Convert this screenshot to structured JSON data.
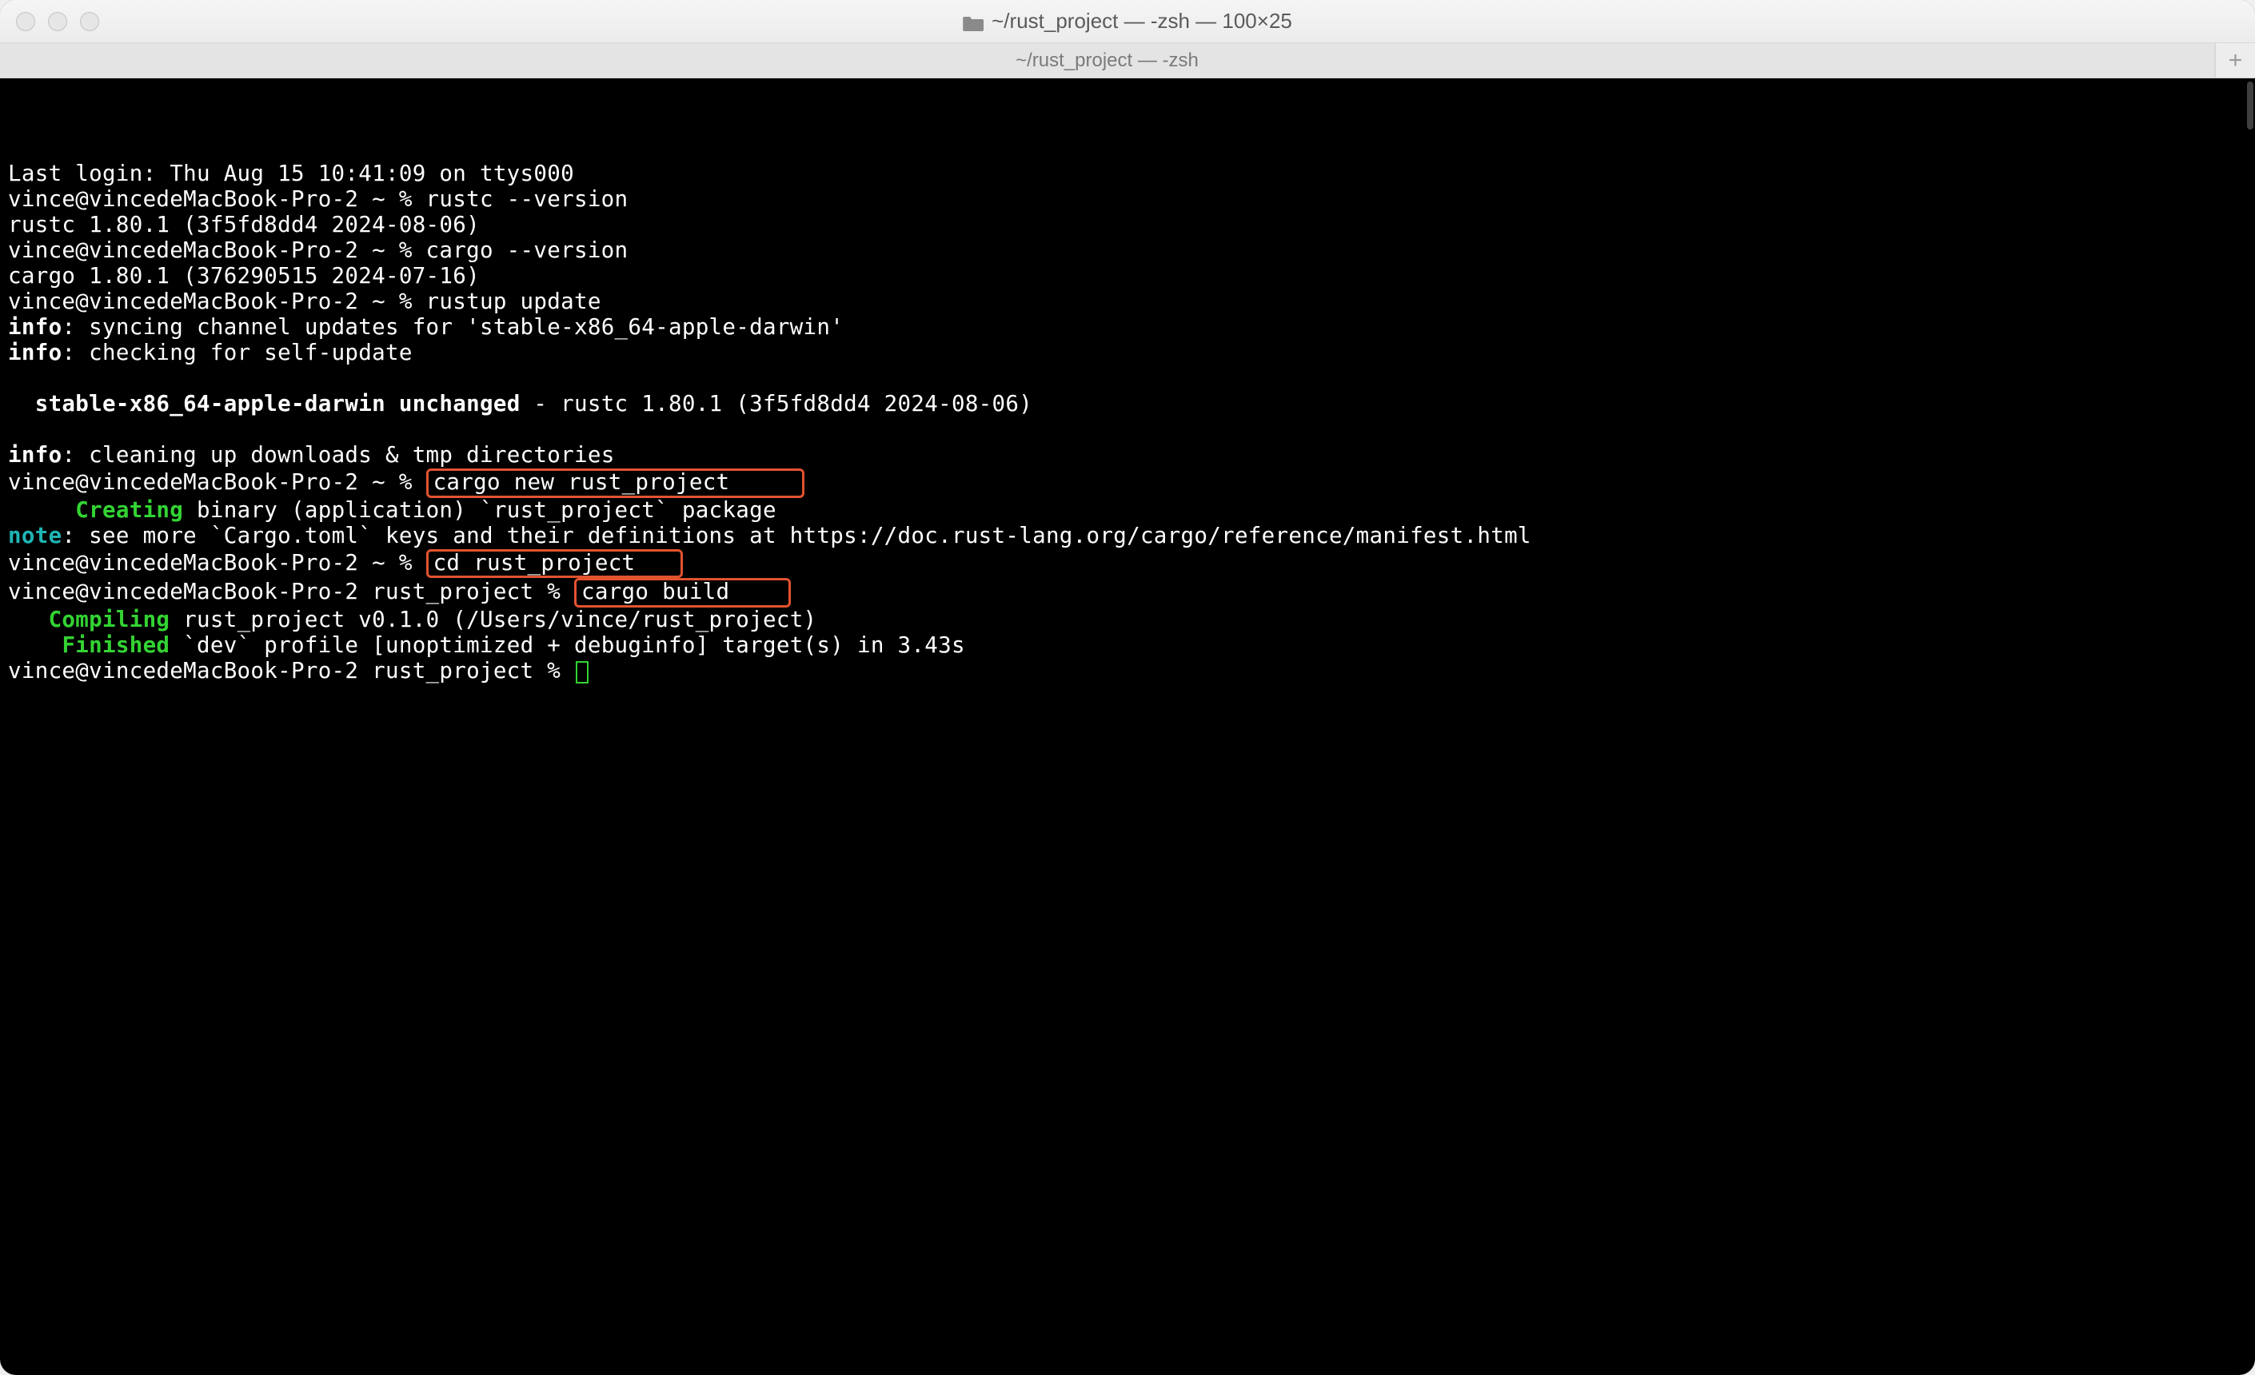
{
  "window": {
    "title": "~/rust_project — -zsh — 100×25"
  },
  "tab": {
    "label": "~/rust_project — -zsh"
  },
  "terminal": {
    "lines": [
      {
        "t": "plain",
        "text": "Last login: Thu Aug 15 10:41:09 on ttys000"
      },
      {
        "t": "prompt",
        "prompt": "vince@vincedeMacBook-Pro-2 ~ %",
        "cmd": "rustc --version"
      },
      {
        "t": "plain",
        "text": "rustc 1.80.1 (3f5fd8dd4 2024-08-06)"
      },
      {
        "t": "prompt",
        "prompt": "vince@vincedeMacBook-Pro-2 ~ %",
        "cmd": "cargo --version"
      },
      {
        "t": "plain",
        "text": "cargo 1.80.1 (376290515 2024-07-16)"
      },
      {
        "t": "prompt",
        "prompt": "vince@vincedeMacBook-Pro-2 ~ %",
        "cmd": "rustup update"
      },
      {
        "t": "info",
        "label": "info",
        "rest": ": syncing channel updates for 'stable-x86_64-apple-darwin'"
      },
      {
        "t": "info",
        "label": "info",
        "rest": ": checking for self-update"
      },
      {
        "t": "blank"
      },
      {
        "t": "status",
        "lead": "  ",
        "bold": "stable-x86_64-apple-darwin unchanged",
        "rest": " - rustc 1.80.1 (3f5fd8dd4 2024-08-06)"
      },
      {
        "t": "blank"
      },
      {
        "t": "info",
        "label": "info",
        "rest": ": cleaning up downloads & tmp directories"
      },
      {
        "t": "prompt_hl",
        "prompt": "vince@vincedeMacBook-Pro-2 ~ %",
        "cmd": "cargo new rust_project",
        "pad": "     "
      },
      {
        "t": "green",
        "lead": "     ",
        "label": "Creating",
        "rest": " binary (application) `rust_project` package"
      },
      {
        "t": "note",
        "label": "note",
        "rest": ": see more `Cargo.toml` keys and their definitions at https://doc.rust-lang.org/cargo/reference/manifest.html"
      },
      {
        "t": "prompt_hl",
        "prompt": "vince@vincedeMacBook-Pro-2 ~ %",
        "cmd": "cd rust_project",
        "pad": "   "
      },
      {
        "t": "prompt_hl",
        "prompt": "vince@vincedeMacBook-Pro-2 rust_project %",
        "cmd": "cargo build",
        "pad": "    "
      },
      {
        "t": "green",
        "lead": "   ",
        "label": "Compiling",
        "rest": " rust_project v0.1.0 (/Users/vince/rust_project)"
      },
      {
        "t": "green",
        "lead": "    ",
        "label": "Finished",
        "rest": " `dev` profile [unoptimized + debuginfo] target(s) in 3.43s"
      },
      {
        "t": "prompt_cursor",
        "prompt": "vince@vincedeMacBook-Pro-2 rust_project %"
      }
    ]
  }
}
